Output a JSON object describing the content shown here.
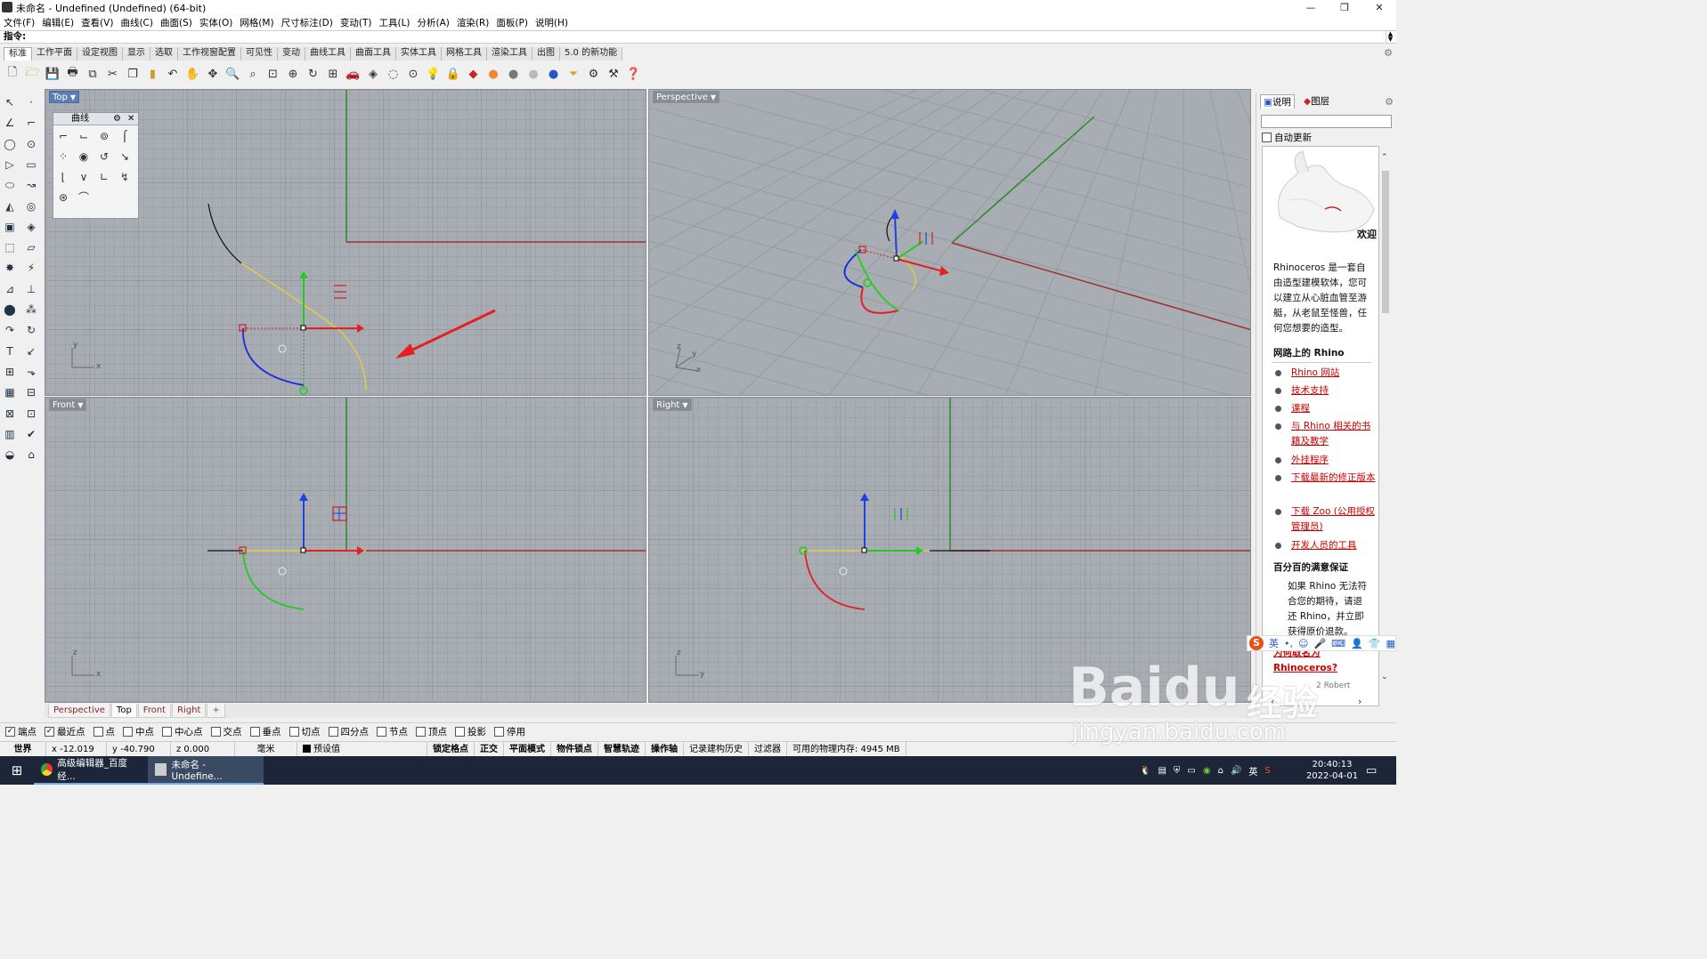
{
  "window": {
    "title": "未命名 - Undefined (Undefined) (64-bit)",
    "min_label": "—",
    "max_label": "❐",
    "close_label": "✕"
  },
  "menu": [
    "文件(F)",
    "编辑(E)",
    "查看(V)",
    "曲线(C)",
    "曲面(S)",
    "实体(O)",
    "网格(M)",
    "尺寸标注(D)",
    "变动(T)",
    "工具(L)",
    "分析(A)",
    "渲染(R)",
    "面板(P)",
    "说明(H)"
  ],
  "command": {
    "label": "指令:"
  },
  "toolbar_tabs": [
    "标准",
    "工作平面",
    "设定视图",
    "显示",
    "选取",
    "工作视窗配置",
    "可见性",
    "变动",
    "曲线工具",
    "曲面工具",
    "实体工具",
    "网格工具",
    "渲染工具",
    "出图",
    "5.0 的新功能"
  ],
  "toolbar_icons": [
    "new-file-icon",
    "open-file-icon",
    "save-icon",
    "print-icon",
    "import-icon",
    "cut-icon",
    "copy-icon",
    "paste-icon",
    "undo-icon",
    "pan-hand-icon",
    "move-view-icon",
    "zoom-icon",
    "zoom-window-icon",
    "zoom-extents-icon",
    "zoom-selected-icon",
    "rotate-view-icon",
    "four-view-icon",
    "car-icon",
    "display-icon",
    "hide-icon",
    "show-icon",
    "lightbulb-icon",
    "lock-icon",
    "layer-icon",
    "color-wheel-icon",
    "sphere-grey-icon",
    "sphere-white-icon",
    "sphere-blue-icon",
    "filter-icon",
    "gear-settings-icon",
    "options-icon",
    "help-icon"
  ],
  "viewports": {
    "top": {
      "label": "Top",
      "axis_x": "x",
      "axis_y": "y"
    },
    "perspective": {
      "label": "Perspective",
      "axis_x": "x",
      "axis_y": "y",
      "axis_z": "z"
    },
    "front": {
      "label": "Front",
      "axis_x": "x",
      "axis_z": "z"
    },
    "right": {
      "label": "Right",
      "axis_y": "y",
      "axis_z": "z"
    }
  },
  "curve_panel": {
    "title": "曲线",
    "gear": "⚙",
    "close": "✕"
  },
  "viewport_tabs": [
    "Perspective",
    "Top",
    "Front",
    "Right"
  ],
  "viewport_tab_add": "+",
  "osnaps": [
    {
      "label": "端点",
      "checked": true
    },
    {
      "label": "最近点",
      "checked": true
    },
    {
      "label": "点",
      "checked": false
    },
    {
      "label": "中点",
      "checked": false
    },
    {
      "label": "中心点",
      "checked": false
    },
    {
      "label": "交点",
      "checked": false
    },
    {
      "label": "垂点",
      "checked": false
    },
    {
      "label": "切点",
      "checked": false
    },
    {
      "label": "四分点",
      "checked": false
    },
    {
      "label": "节点",
      "checked": false
    },
    {
      "label": "顶点",
      "checked": false
    },
    {
      "label": "投影",
      "checked": false
    },
    {
      "label": "停用",
      "checked": false
    }
  ],
  "status": {
    "cplane": "世界",
    "x": "x -12.019",
    "y": "y -40.790",
    "z": "z 0.000",
    "unit": "毫米",
    "layer": "预设值",
    "grid_snap": "锁定格点",
    "ortho": "正交",
    "planar": "平面模式",
    "osnap": "物件锁点",
    "smarttrack": "智慧轨迹",
    "gumball": "操作轴",
    "history": "记录建构历史",
    "filter": "过滤器",
    "memory": "可用的物理内存: 4945 MB"
  },
  "right_panel": {
    "tab_help": "说明",
    "tab_layers": "图层",
    "auto_update": "自动更新",
    "welcome": "欢迎",
    "intro": [
      "Rhinoceros 是一套自",
      "由造型建模软体，您可",
      "以建立从心脏血管至游",
      "艇，从老鼠至怪兽，任",
      "何您想要的造型。"
    ],
    "web_heading": "网路上的 Rhino",
    "links": [
      {
        "text": "Rhino 网站"
      },
      {
        "text": "技术支持"
      },
      {
        "text": "课程"
      },
      {
        "text": "与 Rhino 相关的书籍及教学"
      },
      {
        "text": "外挂程序"
      },
      {
        "text": "下载最新的修正版本"
      },
      {
        "text": "下载 Zoo (公用授权管理员)"
      },
      {
        "text": "开发人员的工具"
      }
    ],
    "guarantee_heading": "百分百的满意保证",
    "guarantee": [
      "如果 Rhino 无法符",
      "合您的期待，请退",
      "还 Rhino，并立即",
      "获得原价退款。"
    ],
    "why_line1": "为何取名为",
    "why_line2": "Rhinoceros?",
    "credit": "2 Robert"
  },
  "ime": {
    "lang": "英"
  },
  "taskbar": {
    "task1": "高级编辑器_百度经...",
    "task2": "未命名 - Undefine...",
    "tray_lang": "英",
    "time": "20:40:13",
    "date": "2022-04-01"
  },
  "watermark": {
    "brand": "Baidu",
    "brand_cn": "经验",
    "url": "jingyan.baidu.com"
  }
}
